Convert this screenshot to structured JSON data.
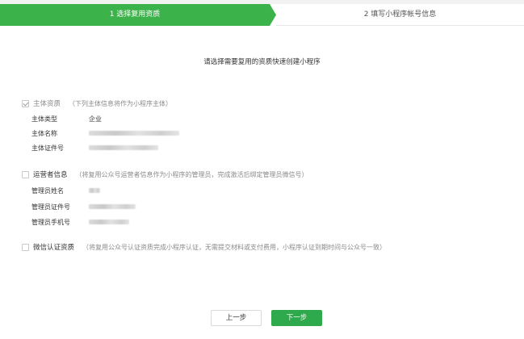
{
  "steps": {
    "step1": "1 选择复用资质",
    "step2": "2 填写小程序帐号信息"
  },
  "intro": "请选择需要复用的资质快速创建小程序",
  "entity": {
    "checked": true,
    "title": "主体资质",
    "note": "（下列主体信息将作为小程序主体）",
    "rows": [
      {
        "label": "主体类型",
        "value": "企业"
      },
      {
        "label": "主体名称",
        "value": ""
      },
      {
        "label": "主体证件号",
        "value": ""
      }
    ]
  },
  "operator": {
    "checked": false,
    "title": "运营者信息",
    "note": "（将复用公众号运营者信息作为小程序的管理员，完成激活后绑定管理员微信号）",
    "rows": [
      {
        "label": "管理员姓名",
        "value": ""
      },
      {
        "label": "管理员证件号",
        "value": ""
      },
      {
        "label": "管理员手机号",
        "value": ""
      }
    ]
  },
  "wechat_verify": {
    "checked": false,
    "title": "微信认证资质",
    "note": "（将复用公众号认证资质完成小程序认证，无需提交材料或支付费用，小程序认证到期时间与公众号一致）"
  },
  "buttons": {
    "prev": "上一步",
    "next": "下一步"
  },
  "colors": {
    "accent": "#3cb34a",
    "button_green": "#2ea94b"
  }
}
